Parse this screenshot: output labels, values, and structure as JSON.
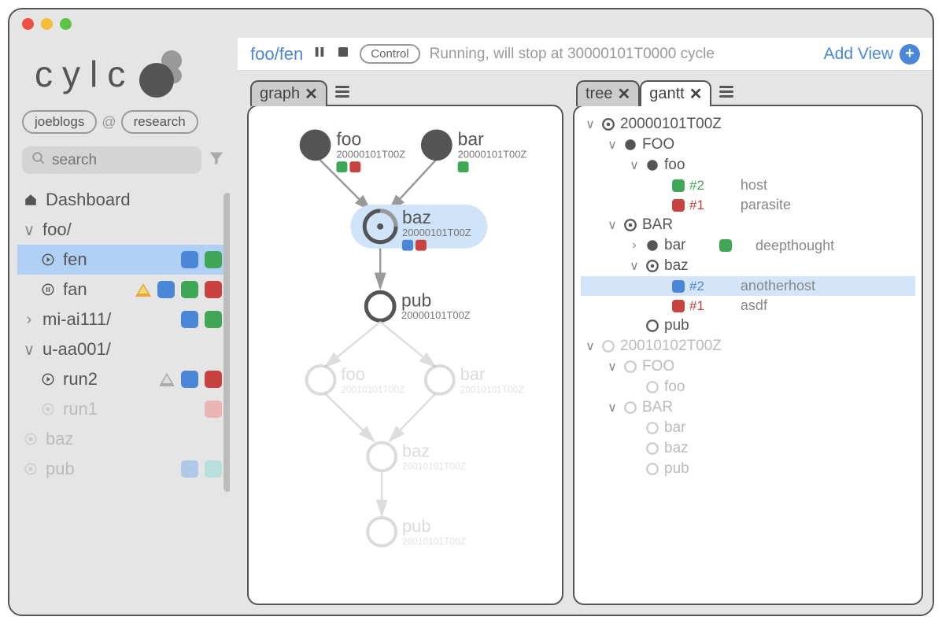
{
  "logo": "cylc",
  "user_pill": "joeblogs",
  "server_pill": "research",
  "search_placeholder": "search",
  "dashboard_label": "Dashboard",
  "nav": {
    "foo_label": "foo/",
    "fen_label": "fen",
    "fan_label": "fan",
    "miai_label": "mi-ai111/",
    "uaa_label": "u-aa001/",
    "run2_label": "run2",
    "run1_label": "run1",
    "baz_label": "baz",
    "pub_label": "pub"
  },
  "toolbar": {
    "workflow": "foo/fen",
    "control_label": "Control",
    "status": "Running, will stop at 30000101T0000 cycle",
    "add_view": "Add View"
  },
  "tabs": {
    "graph": "graph",
    "tree": "tree",
    "gantt": "gantt"
  },
  "graph": {
    "foo": "foo",
    "foo_ts": "20000101T00Z",
    "bar": "bar",
    "bar_ts": "20000101T00Z",
    "baz": "baz",
    "baz_ts": "20000101T00Z",
    "pub": "pub",
    "pub_ts": "20000101T00Z",
    "foo2": "foo",
    "foo2_ts": "20010101T00Z",
    "bar2": "bar",
    "bar2_ts": "20010101T00Z",
    "baz2": "baz",
    "baz2_ts": "20010101T00Z",
    "pub2": "pub",
    "pub2_ts": "20010101T00Z"
  },
  "tree": {
    "cp1": "20000101T00Z",
    "fam_foo": "FOO",
    "task_foo": "foo",
    "foo_j2": "#2",
    "foo_j2_host": "host",
    "foo_j1": "#1",
    "foo_j1_host": "parasite",
    "fam_bar": "BAR",
    "task_bar": "bar",
    "bar_host": "deepthought",
    "task_baz": "baz",
    "baz_j2": "#2",
    "baz_j2_host": "anotherhost",
    "baz_j1": "#1",
    "baz_j1_host": "asdf",
    "task_pub": "pub",
    "cp2": "20010102T00Z",
    "fam_foo2": "FOO",
    "task_foo2": "foo",
    "fam_bar2": "BAR",
    "task_bar2": "bar",
    "task_baz2": "baz",
    "task_pub2": "pub"
  }
}
